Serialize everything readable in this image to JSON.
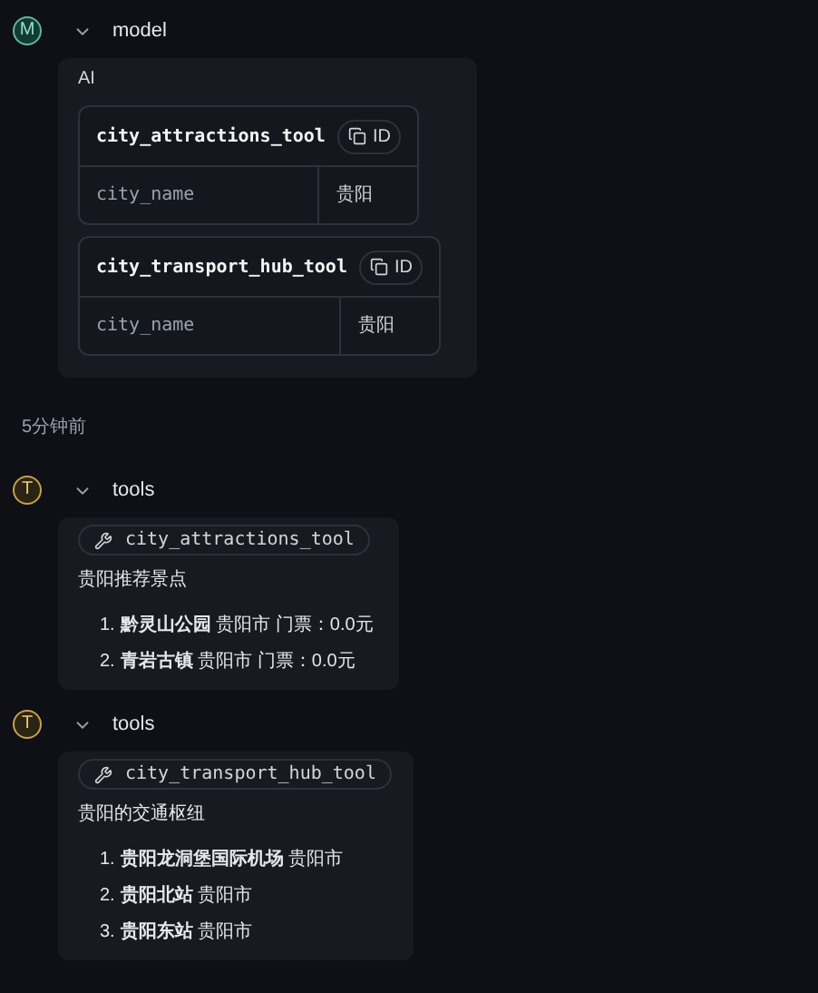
{
  "messages": [
    {
      "kind": "model",
      "avatar": "M",
      "role": "model",
      "expanded": true,
      "label": "AI",
      "tool_calls": [
        {
          "name": "city_attractions_tool",
          "id_button": "ID",
          "args": [
            {
              "key": "city_name",
              "value": "贵阳"
            }
          ]
        },
        {
          "name": "city_transport_hub_tool",
          "id_button": "ID",
          "args": [
            {
              "key": "city_name",
              "value": "贵阳"
            }
          ]
        }
      ]
    },
    {
      "kind": "time",
      "text": "5分钟前"
    },
    {
      "kind": "tool",
      "avatar": "T",
      "role": "tools",
      "expanded": true,
      "tool": "city_attractions_tool",
      "title": "贵阳推荐景点",
      "items": [
        {
          "number": "1.",
          "text": "**黔灵山公园** 贵阳市 门票：0.0元"
        },
        {
          "number": "2.",
          "text": "**青岩古镇** 贵阳市 门票：0.0元"
        }
      ]
    },
    {
      "kind": "tool",
      "avatar": "T",
      "role": "tools",
      "expanded": true,
      "tool": "city_transport_hub_tool",
      "title": "贵阳的交通枢纽",
      "items": [
        {
          "number": "1.",
          "text": "**贵阳龙洞堡国际机场** 贵阳市"
        },
        {
          "number": "2.",
          "text": "**贵阳北站** 贵阳市"
        },
        {
          "number": "3.",
          "text": "**贵阳东站** 贵阳市"
        }
      ]
    }
  ]
}
